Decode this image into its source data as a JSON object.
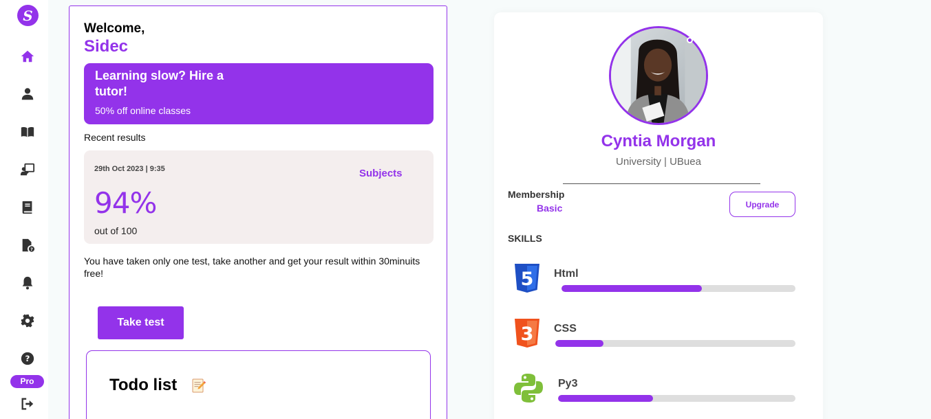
{
  "sidebar": {
    "logo_letter": "S",
    "items": [
      {
        "name": "home",
        "active": true
      },
      {
        "name": "profile"
      },
      {
        "name": "library"
      },
      {
        "name": "classroom"
      },
      {
        "name": "book"
      },
      {
        "name": "test-file"
      },
      {
        "name": "notifications"
      },
      {
        "name": "settings"
      },
      {
        "name": "help"
      }
    ],
    "pro_label": "Pro"
  },
  "main": {
    "welcome": "Welcome,",
    "username": "Sidec",
    "promo": {
      "title": "Learning slow? Hire a tutor!",
      "subtitle": "50% off online classes"
    },
    "recent_label": "Recent results",
    "result": {
      "date": "29th Oct 2023 | 9:35",
      "subjects_link": "Subjects",
      "score": "94%",
      "out_of": "out of 100"
    },
    "info_text": "You have taken only one test, take another and get your result within 30minuits free!",
    "take_test_label": "Take test",
    "todo": {
      "title": "Todo list",
      "icon": "memo-pencil-icon"
    }
  },
  "profile": {
    "name": "Cyntia Morgan",
    "subtitle": "University | UBuea",
    "membership_label": "Membership",
    "membership_value": "Basic",
    "upgrade_label": "Upgrade",
    "skills_label": "SKILLS",
    "skills": [
      {
        "name": "Html",
        "level": 0.6,
        "icon": "html5-icon"
      },
      {
        "name": "CSS",
        "level": 0.2,
        "icon": "css3-icon"
      },
      {
        "name": "Py3",
        "level": 0.4,
        "icon": "python-icon"
      }
    ]
  },
  "colors": {
    "accent": "#9333ea",
    "result_bg": "#f4eeee",
    "track": "#dedede",
    "html5": "#1e4fc4",
    "css3": "#f0521d",
    "python": "#7fbf3a"
  }
}
